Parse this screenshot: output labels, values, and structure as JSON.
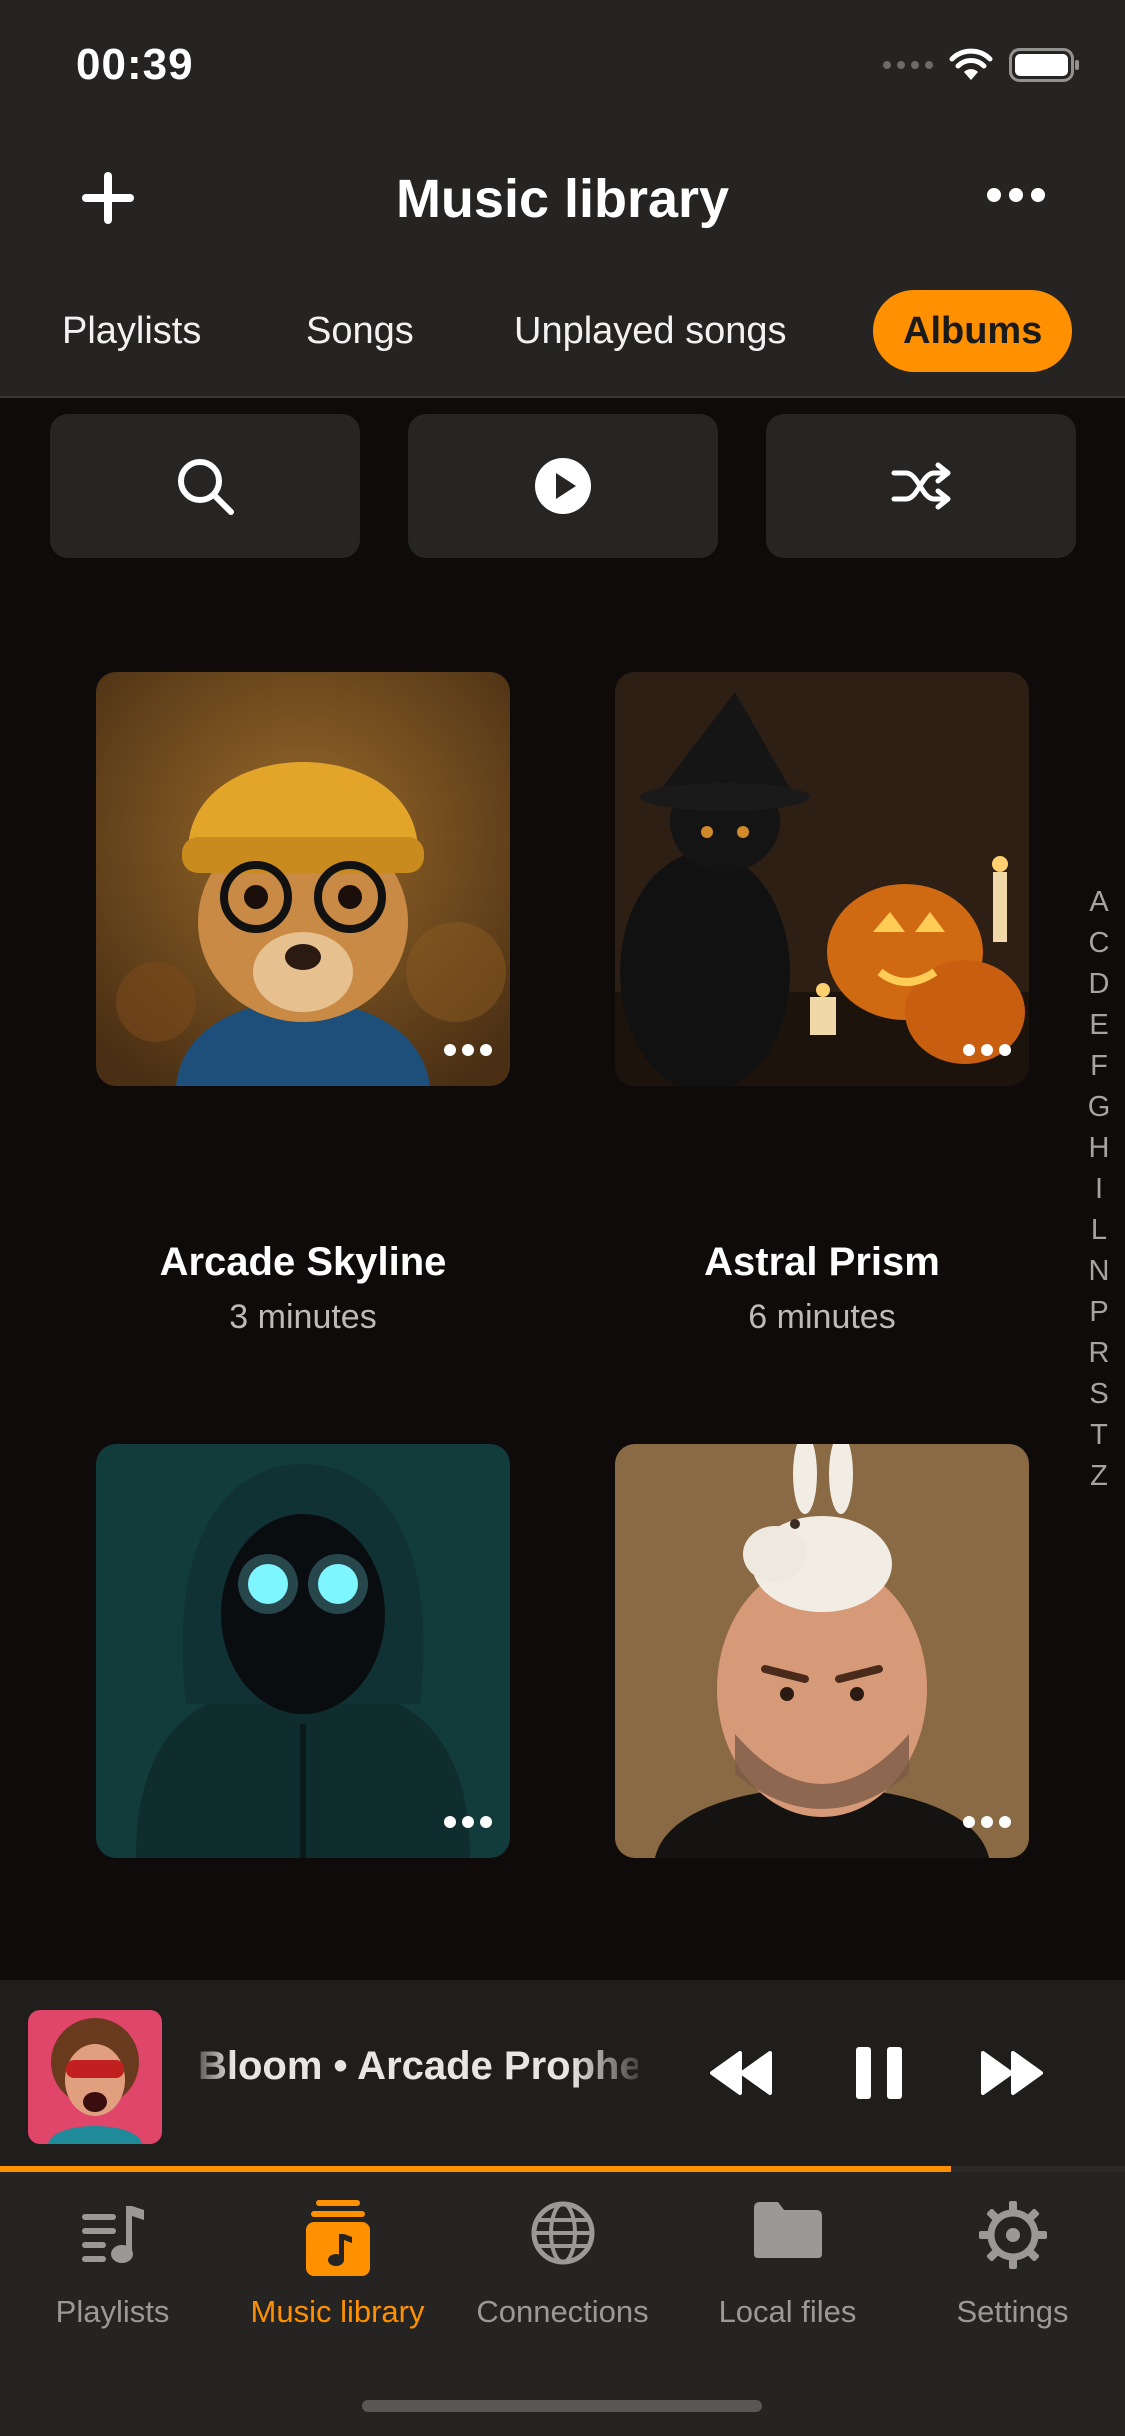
{
  "status": {
    "time": "00:39"
  },
  "header": {
    "title": "Music library"
  },
  "tabs": [
    {
      "label": "Playlists",
      "active": false
    },
    {
      "label": "Songs",
      "active": false
    },
    {
      "label": "Unplayed songs",
      "active": false
    },
    {
      "label": "Albums",
      "active": true
    }
  ],
  "actions": [
    "search",
    "play",
    "shuffle"
  ],
  "albums": [
    {
      "title": "Arcade Skyline",
      "duration": "3 minutes",
      "art": "dog-in-yellow-beanie"
    },
    {
      "title": "Astral Prism",
      "duration": "6 minutes",
      "art": "black-cat-with-pumpkins"
    },
    {
      "title": "",
      "duration": "",
      "art": "hooded-figure-glowing-eyes"
    },
    {
      "title": "",
      "duration": "",
      "art": "bald-man-with-rabbit"
    }
  ],
  "index_letters": [
    "A",
    "C",
    "D",
    "E",
    "F",
    "G",
    "H",
    "I",
    "L",
    "N",
    "P",
    "R",
    "S",
    "T",
    "Z"
  ],
  "player": {
    "now_playing": "Bloom • Arcade Prophets",
    "progress": 0.845
  },
  "tabbar": [
    {
      "label": "Playlists",
      "active": false,
      "icon": "playlists-icon"
    },
    {
      "label": "Music library",
      "active": true,
      "icon": "music-library-icon"
    },
    {
      "label": "Connections",
      "active": false,
      "icon": "globe-icon"
    },
    {
      "label": "Local files",
      "active": false,
      "icon": "folder-icon"
    },
    {
      "label": "Settings",
      "active": false,
      "icon": "gear-icon"
    }
  ],
  "colors": {
    "accent": "#ff9100",
    "bar_bg": "#262423",
    "bg": "#0e0b0a"
  }
}
